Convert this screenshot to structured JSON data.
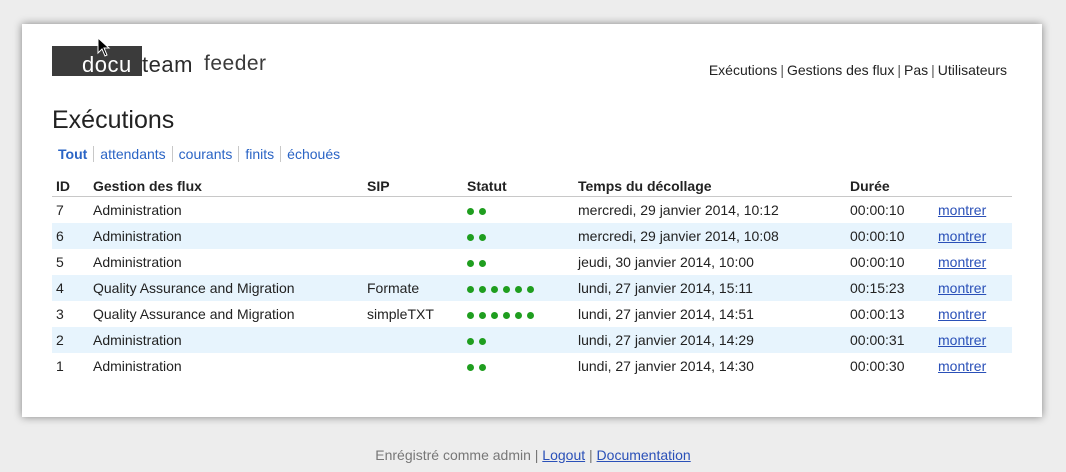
{
  "logo": {
    "part1": "docu",
    "part2": "team",
    "part3": "feeder"
  },
  "topnav": [
    "Exécutions",
    "Gestions des flux",
    "Pas",
    "Utilisateurs"
  ],
  "page_title": "Exécutions",
  "filters": [
    "Tout",
    "attendants",
    "courants",
    "finits",
    "échoués"
  ],
  "table": {
    "headers": [
      "ID",
      "Gestion des flux",
      "SIP",
      "Statut",
      "Temps du décollage",
      "Durée",
      ""
    ],
    "rows": [
      {
        "id": "7",
        "flux": "Administration",
        "sip": "",
        "dots": 2,
        "start": "mercredi, 29 janvier 2014, 10:12",
        "duration": "00:00:10",
        "action": "montrer"
      },
      {
        "id": "6",
        "flux": "Administration",
        "sip": "",
        "dots": 2,
        "start": "mercredi, 29 janvier 2014, 10:08",
        "duration": "00:00:10",
        "action": "montrer"
      },
      {
        "id": "5",
        "flux": "Administration",
        "sip": "",
        "dots": 2,
        "start": "jeudi, 30 janvier 2014, 10:00",
        "duration": "00:00:10",
        "action": "montrer"
      },
      {
        "id": "4",
        "flux": "Quality Assurance and Migration",
        "sip": "Formate",
        "dots": 6,
        "start": "lundi, 27 janvier 2014, 15:11",
        "duration": "00:15:23",
        "action": "montrer"
      },
      {
        "id": "3",
        "flux": "Quality Assurance and Migration",
        "sip": "simpleTXT",
        "dots": 6,
        "start": "lundi, 27 janvier 2014, 14:51",
        "duration": "00:00:13",
        "action": "montrer"
      },
      {
        "id": "2",
        "flux": "Administration",
        "sip": "",
        "dots": 2,
        "start": "lundi, 27 janvier 2014, 14:29",
        "duration": "00:00:31",
        "action": "montrer"
      },
      {
        "id": "1",
        "flux": "Administration",
        "sip": "",
        "dots": 2,
        "start": "lundi, 27 janvier 2014, 14:30",
        "duration": "00:00:30",
        "action": "montrer"
      }
    ]
  },
  "footer": {
    "prefix": "Enrégistré comme admin |",
    "logout": "Logout",
    "sep": "|",
    "docs": "Documentation"
  },
  "colors": {
    "status_dot": "#1f9e1f",
    "link": "#2a50b8",
    "row_alt": "#e7f4fd"
  }
}
